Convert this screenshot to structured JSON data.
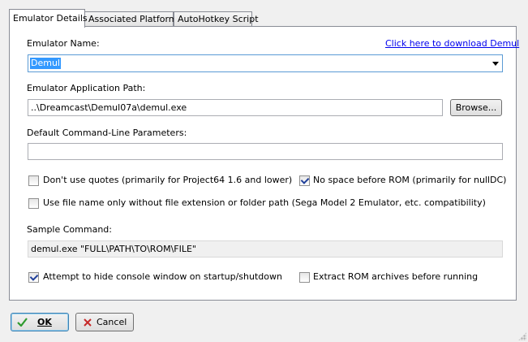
{
  "tabs": [
    {
      "label": "Emulator Details",
      "active": true
    },
    {
      "label": "Associated Platforms",
      "active": false
    },
    {
      "label": "AutoHotkey Script",
      "active": false
    }
  ],
  "emulator_name": {
    "label": "Emulator Name:",
    "value": "Demul",
    "download_link": "Click here to download Demul"
  },
  "app_path": {
    "label": "Emulator Application Path:",
    "value": "..\\Dreamcast\\Demul07a\\demul.exe",
    "browse_label": "Browse..."
  },
  "params": {
    "label": "Default Command-Line Parameters:",
    "value": ""
  },
  "options": {
    "no_quotes": {
      "label": "Don't use quotes (primarily for Project64 1.6 and lower)",
      "checked": false
    },
    "no_space": {
      "label": "No space before ROM (primarily for nullDC)",
      "checked": true
    },
    "file_name_only": {
      "label": "Use file name only without file extension or folder path (Sega Model 2 Emulator, etc. compatibility)",
      "checked": false
    },
    "hide_console": {
      "label": "Attempt to hide console window on startup/shutdown",
      "checked": true
    },
    "extract_rom": {
      "label": "Extract ROM archives before running",
      "checked": false
    }
  },
  "sample": {
    "label": "Sample Command:",
    "value": "demul.exe \"FULL\\PATH\\TO\\ROM\\FILE\""
  },
  "buttons": {
    "ok": {
      "label": "OK"
    },
    "cancel": {
      "label": "Cancel"
    }
  },
  "colors": {
    "accent": "#3399ff",
    "link": "#0000ee",
    "check": "#21409a"
  }
}
